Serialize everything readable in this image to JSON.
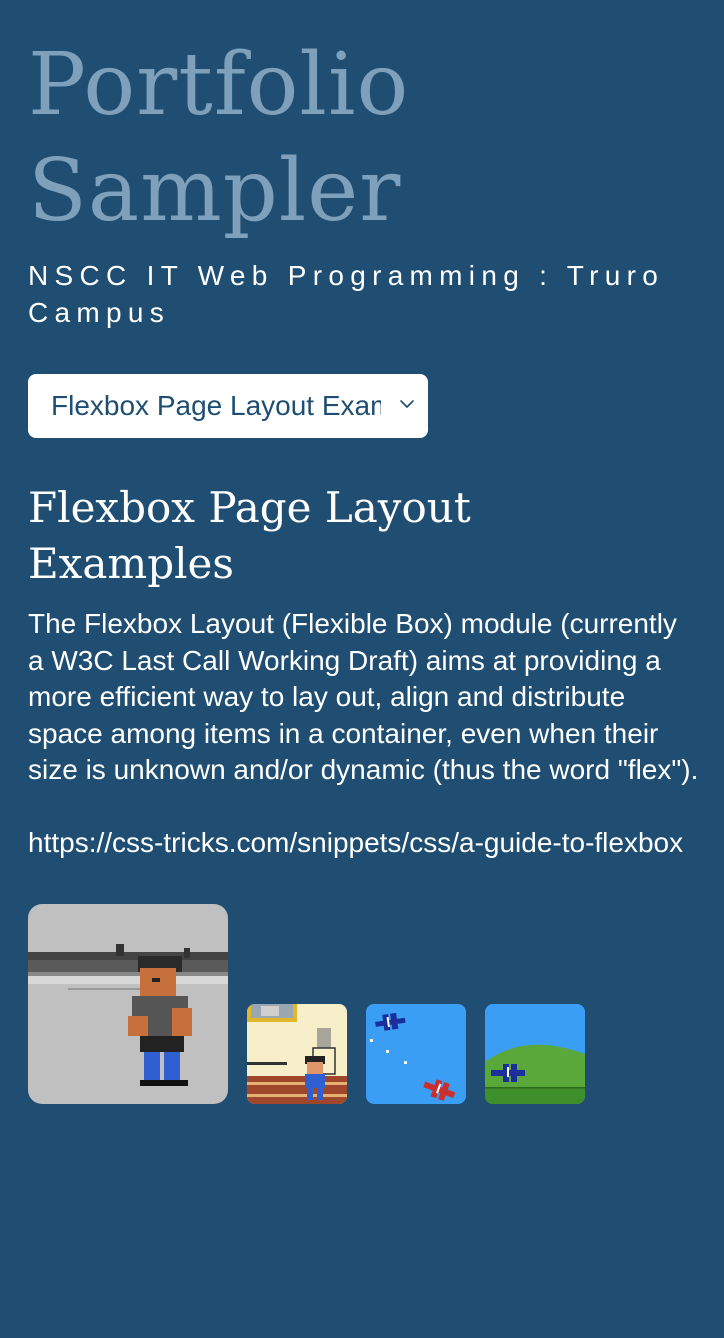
{
  "header": {
    "title": "Portfolio Sampler",
    "subtitle": "NSCC IT Web Programming : Truro Campus"
  },
  "nav_select": {
    "selected": "Flexbox Page Layout Examples",
    "chevron_icon": "chevron-down-icon"
  },
  "main": {
    "heading": "Flexbox Page Layout Examples",
    "description": "The Flexbox Layout (Flexible Box) module (currently a W3C Last Call Working Draft) aims at providing a more efficient way to lay out, align and distribute space among items in a container, even when their size is unknown and/or dynamic (thus the word \"flex\").",
    "link": "https://css-tricks.com/snippets/css/a-guide-to-flexbox"
  },
  "gallery": {
    "thumbnails": [
      {
        "name": "pixel-brawler-thumbnail",
        "selected": true
      },
      {
        "name": "pixel-room-thumbnail",
        "selected": false
      },
      {
        "name": "biplanes-sky-thumbnail",
        "selected": false
      },
      {
        "name": "biplane-hills-thumbnail",
        "selected": false
      }
    ]
  },
  "colors": {
    "background": "#1f4e72",
    "title": "#7fa0bb",
    "text": "#ffffff",
    "select_text": "#1f4e72",
    "sky": "#3b9ef5",
    "grass": "#4fa33a"
  }
}
